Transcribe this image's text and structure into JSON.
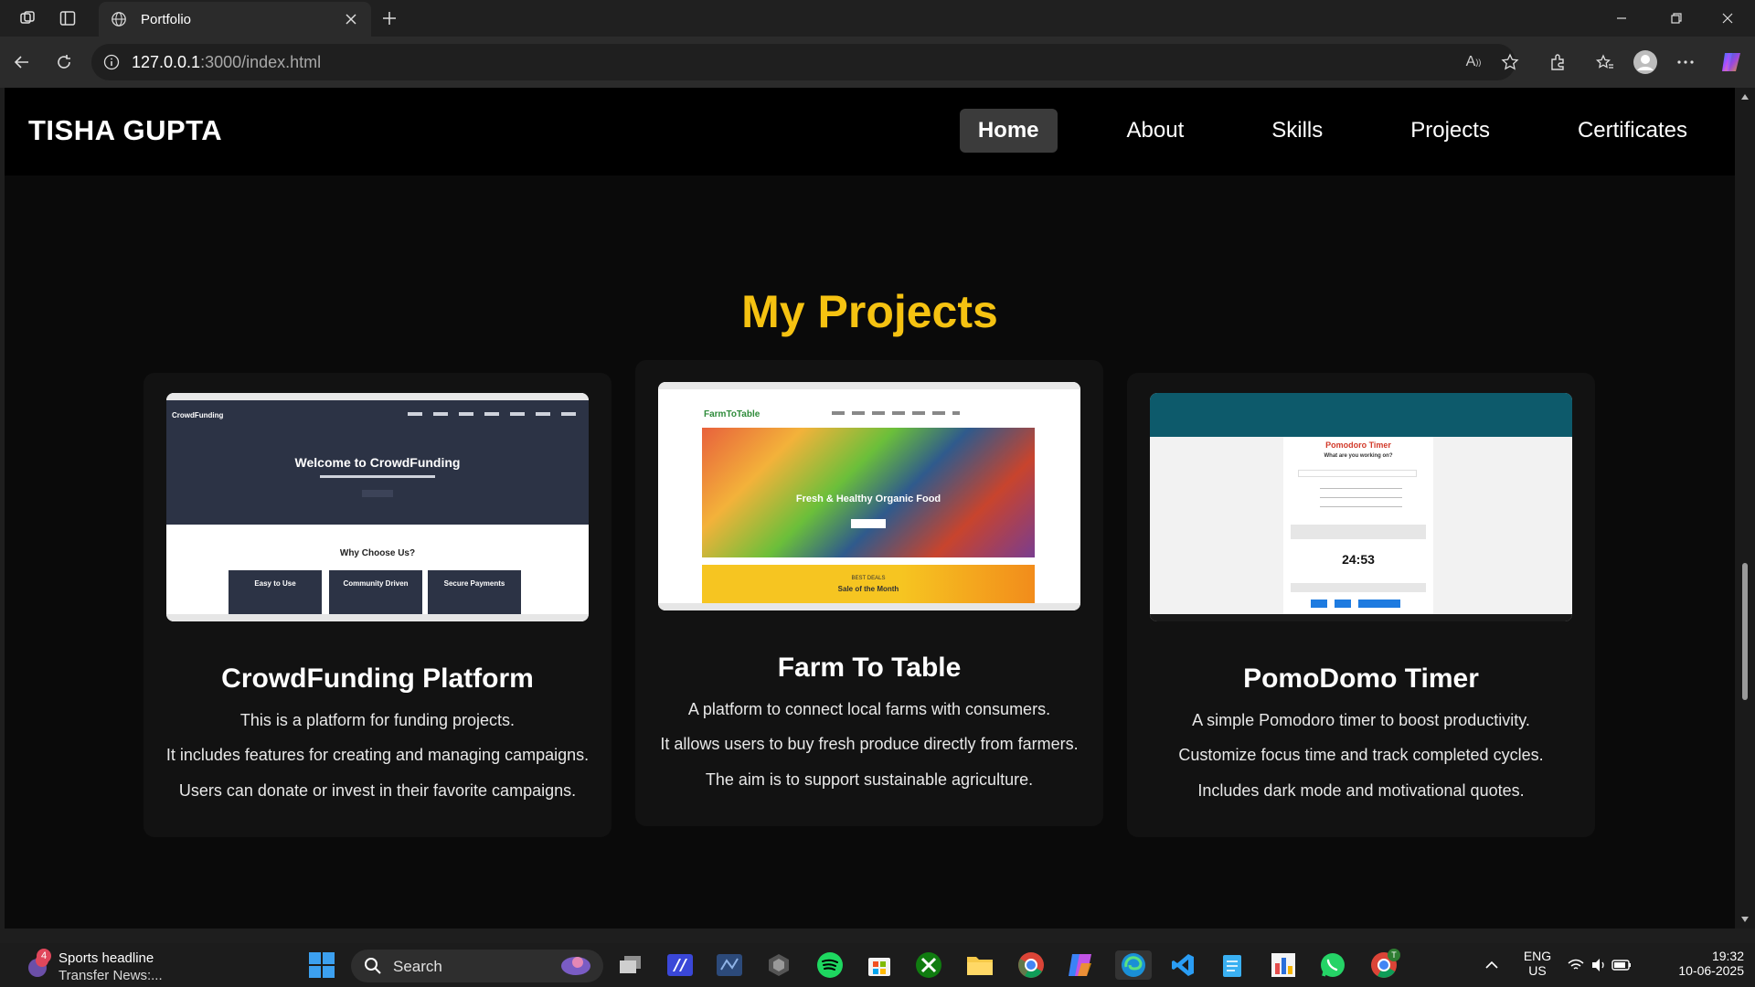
{
  "browser": {
    "tab_title": "Portfolio",
    "url_host": "127.0.0.1",
    "url_rest": ":3000/index.html"
  },
  "site": {
    "brand": "TISHA GUPTA",
    "nav": [
      {
        "label": "Home"
      },
      {
        "label": "About"
      },
      {
        "label": "Skills"
      },
      {
        "label": "Projects"
      },
      {
        "label": "Certificates"
      }
    ],
    "section_title": "My Projects",
    "projects": [
      {
        "title": "CrowdFunding Platform",
        "lines": [
          "This is a platform for funding projects.",
          "It includes features for creating and managing campaigns.",
          "Users can donate or invest in their favorite campaigns."
        ],
        "shot": {
          "brand": "CrowdFunding",
          "hero": "Welcome to CrowdFunding",
          "why": "Why Choose Us?",
          "boxes": [
            "Easy to Use",
            "Community Driven",
            "Secure Payments"
          ]
        }
      },
      {
        "title": "Farm To Table",
        "lines": [
          "A platform to connect local farms with consumers.",
          "It allows users to buy fresh produce directly from farmers.",
          "The aim is to support sustainable agriculture."
        ],
        "shot": {
          "brand": "FarmToTable",
          "hero": "Fresh & Healthy Organic Food",
          "deals_kicker": "BEST DEALS",
          "deals": "Sale of the Month"
        }
      },
      {
        "title": "PomoDomo Timer",
        "lines": [
          "A simple Pomodoro timer to boost productivity.",
          "Customize focus time and track completed cycles.",
          "Includes dark mode and motivational quotes."
        ],
        "shot": {
          "heading": "Pomodoro Timer",
          "question": "What are you working on?",
          "time": "24:53"
        }
      }
    ]
  },
  "taskbar": {
    "news_badge": "4",
    "news_title": "Sports headline",
    "news_sub": "Transfer News:...",
    "search_label": "Search",
    "lang_line1": "ENG",
    "lang_line2": "US",
    "time": "19:32",
    "date": "10-06-2025",
    "chrome_badge": "T"
  },
  "colors": {
    "accent_yellow": "#f5c211",
    "page_bg": "#0a0a0a",
    "card_bg": "#121212",
    "nav_active_bg": "#3b3b3b"
  },
  "icons": [
    "workspaces-icon",
    "vertical-tabs-icon",
    "globe-icon",
    "close-icon",
    "plus-icon",
    "minimize-icon",
    "restore-icon",
    "back-icon",
    "refresh-icon",
    "info-icon",
    "read-aloud-icon",
    "favorite-star-icon",
    "extensions-icon",
    "favorites-icon",
    "profile-icon",
    "more-icon",
    "copilot-icon",
    "windows-start-icon"
  ]
}
